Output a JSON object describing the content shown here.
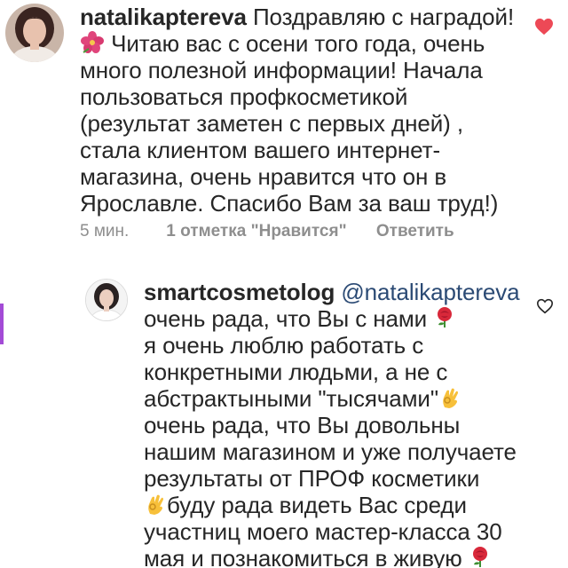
{
  "accent_colors": {
    "text": "#262626",
    "secondary": "#8e8e8e",
    "mention": "#2b4a74",
    "liked_heart": "#ed4956",
    "edge_mark": "#a34bd6"
  },
  "comment": {
    "username": "natalikaptereva",
    "avatar_icon": "profile-photo",
    "lines": [
      "Поздравляю с наградой!",
      "Читаю вас с осени того года, очень",
      "много полезной информации! Начала",
      "пользоваться профкосметикой",
      "(результат заметен с первых дней) ,",
      "стала клиентом вашего интернет-",
      "магазина, очень нравится что он в",
      "Ярославле. Спасибо Вам за ваш труд!)"
    ],
    "emojis": [
      "hibiscus-emoji"
    ],
    "time": "5 мин.",
    "likes": "1 отметка \"Нравится\"",
    "reply_label": "Ответить",
    "liked": true,
    "like_icon": "heart-filled-icon"
  },
  "reply": {
    "username": "smartcosmetolog",
    "avatar_icon": "profile-photo",
    "mention": "@natalikaptereva",
    "lines": [
      "очень рада, что Вы с нами",
      "я очень люблю работать с",
      "конкретными людьми, а не с",
      "абстрактыными \"тысячами\"",
      "очень рада, что Вы довольны",
      "нашим магазином и уже получаете",
      "результаты от ПРОФ косметики",
      "буду рада видеть Вас среди",
      "участниц моего мастер-класса 30",
      "мая и познакомиться в живую"
    ],
    "emojis": [
      "rose-emoji",
      "ok-hand-emoji"
    ],
    "liked": false,
    "like_icon": "heart-outline-icon"
  }
}
